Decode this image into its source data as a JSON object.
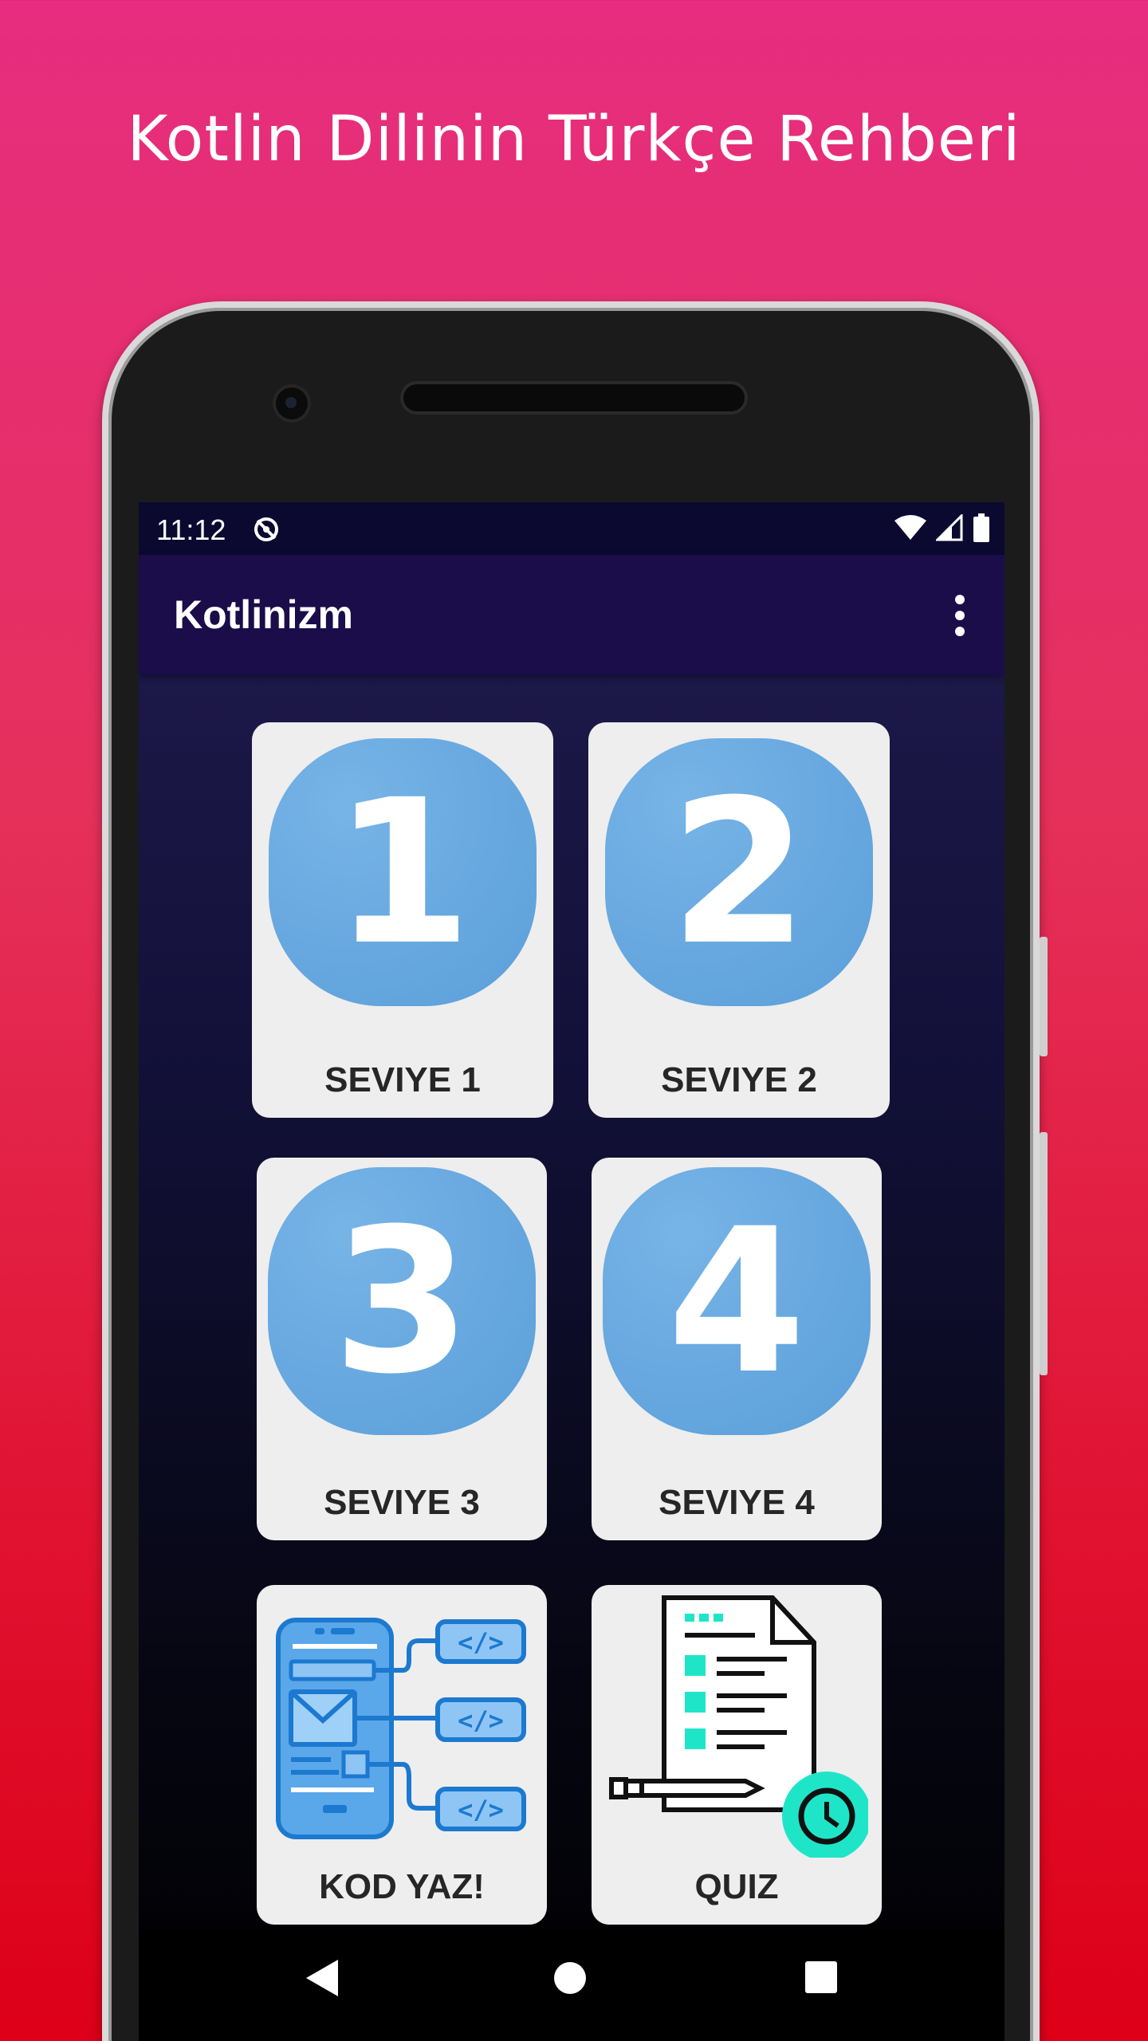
{
  "promo": {
    "title": "Kotlin Dilinin Türkçe Rehberi"
  },
  "status_bar": {
    "time": "11:12",
    "icons": [
      "sync-disabled-icon",
      "wifi-icon",
      "signal-icon",
      "battery-icon"
    ]
  },
  "app_bar": {
    "title": "Kotlinizm",
    "menu_icon": "more-vert-icon"
  },
  "cards": [
    {
      "label": "SEVIYE 1",
      "tile": "1"
    },
    {
      "label": "SEVIYE 2",
      "tile": "2"
    },
    {
      "label": "SEVIYE 3",
      "tile": "3"
    },
    {
      "label": "SEVIYE 4",
      "tile": "4"
    },
    {
      "label": "KOD YAZ!",
      "icon": "code-app-icon"
    },
    {
      "label": "QUIZ",
      "icon": "quiz-document-icon"
    }
  ],
  "nav_bar": {
    "buttons": [
      "back-icon",
      "home-icon",
      "recents-icon"
    ]
  },
  "colors": {
    "background_top": "#e62d7f",
    "background_bottom": "#dd0018",
    "app_bar": "#1a0d4a",
    "status_bar": "#0b0930",
    "tile_blue": "#6aaae1",
    "card": "#eeeeee",
    "quiz_accent": "#1fe5c8"
  }
}
